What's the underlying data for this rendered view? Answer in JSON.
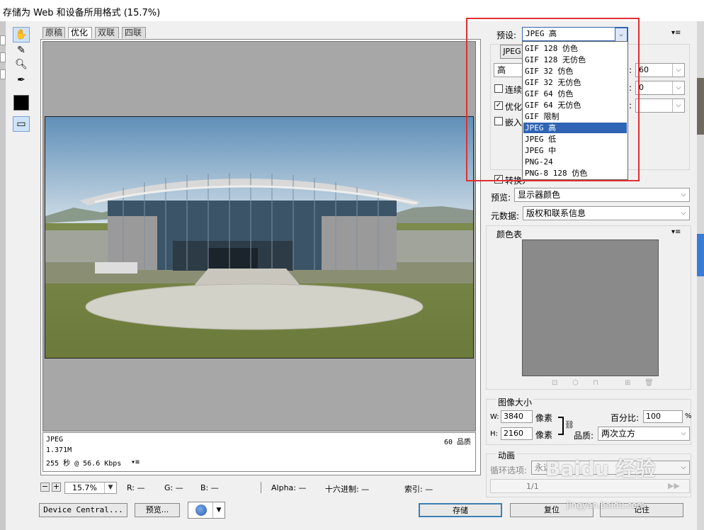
{
  "window": {
    "title": "存储为 Web 和设备所用格式 (15.7%)"
  },
  "tabs": [
    {
      "label": "原稿"
    },
    {
      "label": "优化"
    },
    {
      "label": "双联"
    },
    {
      "label": "四联"
    }
  ],
  "info": {
    "format": "JPEG",
    "size": "1.371M",
    "time": "255 秒 @ 56.6 Kbps",
    "quality": "60 品质"
  },
  "status": {
    "zoom": "15.7%",
    "r": "R: —",
    "g": "G: —",
    "b": "B: —",
    "alpha": "Alpha: —",
    "hex": "十六进制: —",
    "index": "索引: —"
  },
  "bottom_buttons": {
    "device_central": "Device Central...",
    "preview": "预览...",
    "save": "存储",
    "reset": "复位",
    "remember": "记住"
  },
  "preset": {
    "label": "预设:",
    "value": "JPEG 高",
    "options": [
      "GIF 128 仿色",
      "GIF 128 无仿色",
      "GIF 32 仿色",
      "GIF 32 无仿色",
      "GIF 64 仿色",
      "GIF 64 无仿色",
      "GIF 限制",
      "JPEG 高",
      "JPEG 低",
      "JPEG 中",
      "PNG-24",
      "PNG-8 128 仿色"
    ],
    "selected_index": 7
  },
  "settings": {
    "format_partial": "JPEG",
    "quality_level": "高",
    "quality_value": "60",
    "blur_value": "0",
    "progressive": "连续",
    "optimized": "优化",
    "embed": "嵌入",
    "convert": "转换为 sRGB",
    "preview_label": "预览:",
    "preview_value": "显示器颜色",
    "metadata_label": "元数据:",
    "metadata_value": "版权和联系信息"
  },
  "color_table": {
    "title": "颜色表"
  },
  "image_size": {
    "title": "图像大小",
    "w_label": "W:",
    "w_value": "3840",
    "h_label": "H:",
    "h_value": "2160",
    "unit": "像素",
    "percent_label": "百分比:",
    "percent_value": "100",
    "percent_unit": "%",
    "quality_label": "品质:",
    "quality_value": "两次立方"
  },
  "animation": {
    "title": "动画",
    "loop_label": "循环选项:",
    "loop_value": "永远",
    "frame": "1/1"
  },
  "watermark": {
    "logo": "Baidu 经验",
    "url": "jingyan.baidu.com"
  },
  "colors": {
    "accent": "#3064b4",
    "highlight_box": "#e03030",
    "canvas": "#a7a7a7"
  }
}
